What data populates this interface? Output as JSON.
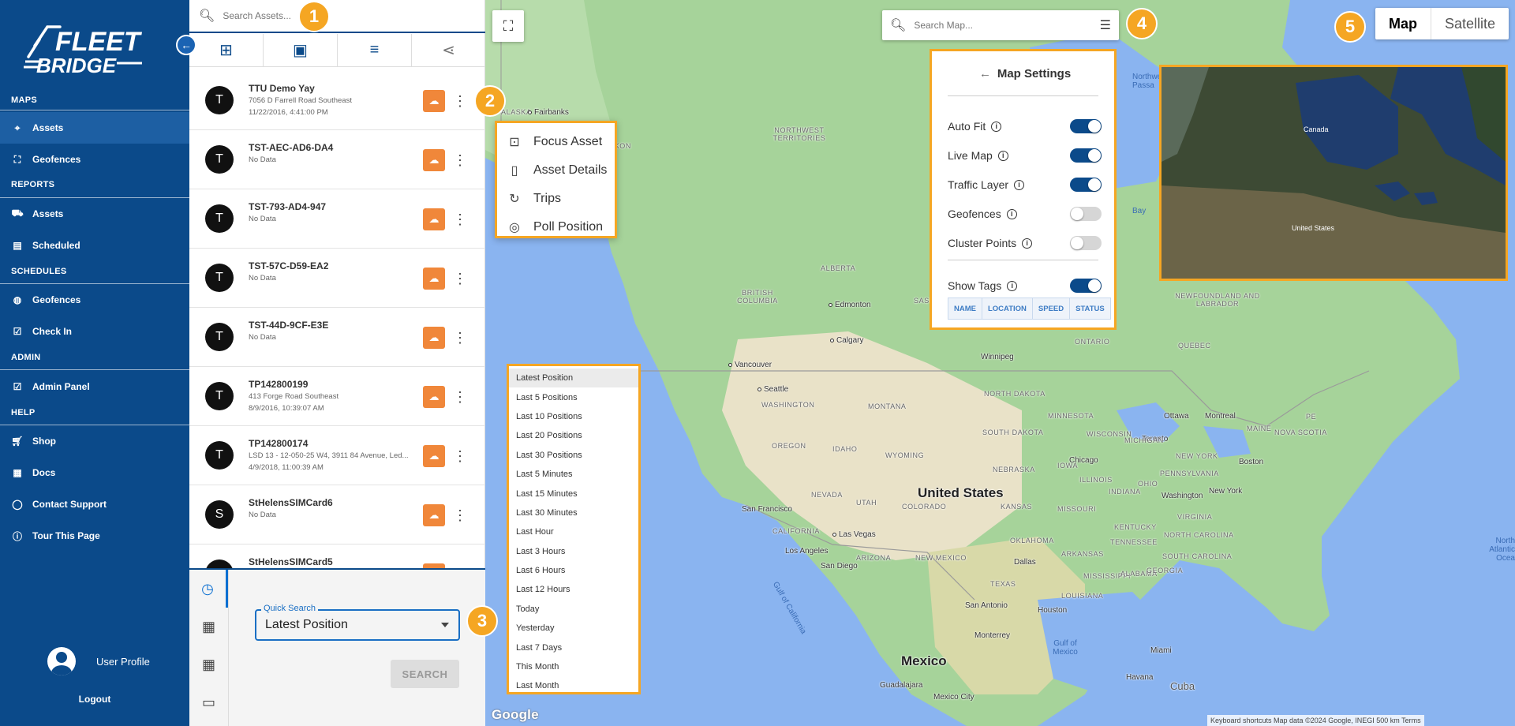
{
  "sidebar": {
    "brand": "FLEET BRIDGE",
    "sections": [
      {
        "title": "MAPS",
        "items": [
          {
            "label": "Assets",
            "icon": "location-icon",
            "active": true
          },
          {
            "label": "Geofences",
            "icon": "geofence-icon"
          }
        ]
      },
      {
        "title": "REPORTS",
        "items": [
          {
            "label": "Assets",
            "icon": "car-icon"
          },
          {
            "label": "Scheduled",
            "icon": "calendar-icon"
          }
        ]
      },
      {
        "title": "SCHEDULES",
        "items": [
          {
            "label": "Geofences",
            "icon": "globe-icon"
          },
          {
            "label": "Check In",
            "icon": "calendar-check-icon"
          }
        ]
      },
      {
        "title": "ADMIN",
        "items": [
          {
            "label": "Admin Panel",
            "icon": "calendar-check-icon"
          }
        ]
      },
      {
        "title": "HELP",
        "items": [
          {
            "label": "Shop",
            "icon": "cart-icon"
          },
          {
            "label": "Docs",
            "icon": "docs-icon"
          },
          {
            "label": "Contact Support",
            "icon": "support-icon"
          },
          {
            "label": "Tour This Page",
            "icon": "info-icon"
          }
        ]
      }
    ],
    "profile_label": "User Profile",
    "logout_label": "Logout"
  },
  "panel": {
    "search_placeholder": "Search Assets...",
    "assets": [
      {
        "initial": "T",
        "name": "TTU Demo Yay",
        "line1": "7056 D Farrell Road Southeast",
        "line2": "11/22/2016, 4:41:00 PM"
      },
      {
        "initial": "T",
        "name": "TST-AEC-AD6-DA4",
        "line1": "No Data",
        "line2": ""
      },
      {
        "initial": "T",
        "name": "TST-793-AD4-947",
        "line1": "No Data",
        "line2": ""
      },
      {
        "initial": "T",
        "name": "TST-57C-D59-EA2",
        "line1": "No Data",
        "line2": ""
      },
      {
        "initial": "T",
        "name": "TST-44D-9CF-E3E",
        "line1": "No Data",
        "line2": ""
      },
      {
        "initial": "T",
        "name": "TP142800199",
        "line1": "413 Forge Road Southeast",
        "line2": "8/9/2016, 10:39:07 AM"
      },
      {
        "initial": "T",
        "name": "TP142800174",
        "line1": "LSD 13 - 12-050-25 W4, 3911 84 Avenue, Led...",
        "line2": "4/9/2018, 11:00:39 AM"
      },
      {
        "initial": "S",
        "name": "StHelensSIMCard6",
        "line1": "No Data",
        "line2": ""
      },
      {
        "initial": "S",
        "name": "StHelensSIMCard5",
        "line1": "",
        "line2": ""
      }
    ],
    "quick_search_label": "Quick Search",
    "quick_search_value": "Latest Position",
    "search_button": "SEARCH"
  },
  "map": {
    "search_placeholder": "Search Map...",
    "map_type": {
      "map": "Map",
      "satellite": "Satellite"
    },
    "context_menu": [
      "Focus Asset",
      "Asset Details",
      "Trips",
      "Poll Position"
    ],
    "time_options": [
      "Latest Position",
      "Last 5 Positions",
      "Last 10 Positions",
      "Last 20 Positions",
      "Last 30 Positions",
      "Last 5 Minutes",
      "Last 15 Minutes",
      "Last 30 Minutes",
      "Last Hour",
      "Last 3 Hours",
      "Last 6 Hours",
      "Last 12 Hours",
      "Today",
      "Yesterday",
      "Last 7 Days",
      "This Month",
      "Last Month"
    ],
    "settings": {
      "title": "Map Settings",
      "toggles": [
        {
          "label": "Auto Fit",
          "on": true
        },
        {
          "label": "Live Map",
          "on": true
        },
        {
          "label": "Traffic Layer",
          "on": true
        },
        {
          "label": "Geofences",
          "on": false
        },
        {
          "label": "Cluster Points",
          "on": false
        },
        {
          "label": "Show Tags",
          "on": true
        }
      ],
      "tag_buttons": [
        "NAME",
        "LOCATION",
        "SPEED",
        "STATUS"
      ]
    },
    "labels": {
      "country_us": "United States",
      "country_mx": "Mexico",
      "alaska": "ALASKA",
      "fairbanks": "Fairbanks",
      "yukon": "YUKON",
      "nwt": "NORTHWEST TERRITORIES",
      "alberta": "ALBERTA",
      "bc": "BRITISH COLUMBIA",
      "sask": "SASKATCH",
      "edmonton": "Edmonton",
      "calgary": "Calgary",
      "vancouver": "Vancouver",
      "seattle": "Seattle",
      "washington": "WASHINGTON",
      "oregon": "OREGON",
      "idaho": "IDAHO",
      "montana": "MONTANA",
      "wyoming": "WYOMING",
      "nevada": "NEVADA",
      "utah": "UTAH",
      "colorado": "COLORADO",
      "california": "CALIFORNIA",
      "sf": "San Francisco",
      "lv": "Las Vegas",
      "la": "Los Angeles",
      "sd": "San Diego",
      "arizona": "ARIZONA",
      "newmexico": "NEW MEXICO",
      "texas": "TEXAS",
      "dallas": "Dallas",
      "houston": "Houston",
      "sanantonio": "San Antonio",
      "monterrey": "Monterrey",
      "guadalajara": "Guadalajara",
      "mexicocity": "Mexico City",
      "winnipeg": "Winnipeg",
      "ontario": "ONTARIO",
      "quebec": "QUEBEC",
      "ottawa": "Ottawa",
      "montreal": "Montreal",
      "toronto": "Toronto",
      "chicago": "Chicago",
      "ny": "New York",
      "boston": "Boston",
      "washington_dc": "Washington",
      "miami": "Miami",
      "havana": "Havana",
      "cuba": "Cuba",
      "nd": "NORTH DAKOTA",
      "sdk": "SOUTH DAKOTA",
      "nebraska": "NEBRASKA",
      "kansas": "KANSAS",
      "oklahoma": "OKLAHOMA",
      "minnesota": "MINNESOTA",
      "iowa": "IOWA",
      "missouri": "MISSOURI",
      "wisconsin": "WISCONSIN",
      "michigan": "MICHIGAN",
      "illinois": "ILLINOIS",
      "indiana": "INDIANA",
      "ohio": "OHIO",
      "kentucky": "KENTUCKY",
      "tennessee": "TENNESSEE",
      "arkansas": "ARKANSAS",
      "mississippi": "MISSISSIPPI",
      "alabama": "ALABAMA",
      "georgia": "GEORGIA",
      "louisiana": "LOUISIANA",
      "ncarolina": "NORTH CAROLINA",
      "scarolina": "SOUTH CAROLINA",
      "virginia": "VIRGINIA",
      "pennsylvania": "PENNSYLVANIA",
      "newyork": "NEW YORK",
      "maine": "MAINE",
      "novascotia": "NOVA SCOTIA",
      "newfoundland": "NEWFOUNDLAND AND LABRADOR",
      "gulfmex": "Gulf of Mexico",
      "gulfcal": "Gulf of California",
      "northatl": "North Atlantic Ocea",
      "hudson": "Bay",
      "northwest_passage": "Northwe Passa",
      "pe": "PE"
    },
    "attribution": "Keyboard shortcuts  Map data ©2024 Google, INEGI   500 km  Terms",
    "google": "Google"
  },
  "callouts": [
    "1",
    "2",
    "3",
    "4",
    "5"
  ],
  "colors": {
    "brand": "#0b4a8a",
    "accent": "#f5a623",
    "cloud": "#f0873a"
  }
}
